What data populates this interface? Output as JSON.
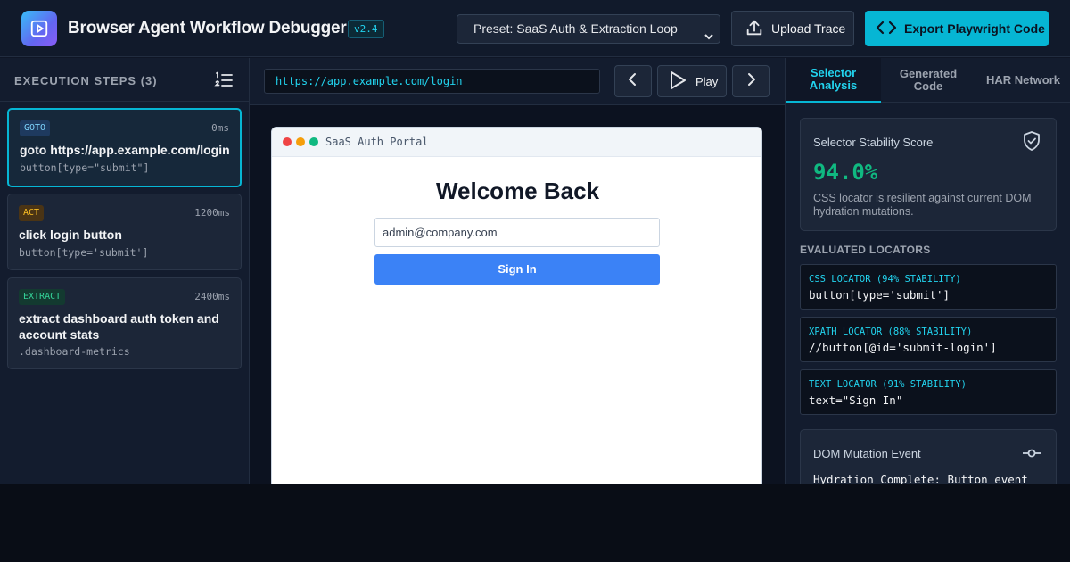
{
  "header": {
    "title": "Browser Agent Workflow Debugger",
    "version": "v2.4",
    "preset": "Preset: SaaS Auth & Extraction Loop",
    "upload_label": "Upload Trace",
    "export_label": "Export Playwright Code"
  },
  "steps_panel": {
    "title": "EXECUTION STEPS (3)",
    "steps": [
      {
        "tag": "GOTO",
        "duration": "0ms",
        "title": "goto https://app.example.com/login",
        "selector": "button[type=\"submit\"]"
      },
      {
        "tag": "ACT",
        "duration": "1200ms",
        "title": "click login button",
        "selector": "button[type='submit']"
      },
      {
        "tag": "EXTRACT",
        "duration": "2400ms",
        "title": "extract dashboard auth token and account stats",
        "selector": ".dashboard-metrics"
      }
    ]
  },
  "browser": {
    "url": "https://app.example.com/login",
    "play_label": "Play",
    "frame_title": "SaaS Auth Portal",
    "heading": "Welcome Back",
    "email_value": "admin@company.com",
    "signin_label": "Sign In"
  },
  "analysis": {
    "tabs": [
      "Selector Analysis",
      "Generated Code",
      "HAR Network"
    ],
    "stability_label": "Selector Stability Score",
    "stability_score": "94.0%",
    "stability_desc": "CSS locator is resilient against current DOM hydration mutations.",
    "locators_title": "EVALUATED LOCATORS",
    "locators": [
      {
        "label": "CSS LOCATOR (94% STABILITY)",
        "value": "button[type='submit']"
      },
      {
        "label": "XPATH LOCATOR (88% STABILITY)",
        "value": "//button[@id='submit-login']"
      },
      {
        "label": "TEXT LOCATOR (91% STABILITY)",
        "value": "text=\"Sign In\""
      }
    ],
    "dom_label": "DOM Mutation Event",
    "dom_text": "Hydration Complete: Button event"
  },
  "colors": {
    "accent": "#06b6d4",
    "success": "#10b981",
    "primary_button": "#3b82f6"
  },
  "icons": [
    "play-square-icon",
    "chevron-down-icon",
    "upload-icon",
    "code-icon",
    "list-ordered-icon",
    "chevron-left-icon",
    "play-icon",
    "chevron-right-icon",
    "shield-check-icon",
    "git-commit-icon"
  ]
}
